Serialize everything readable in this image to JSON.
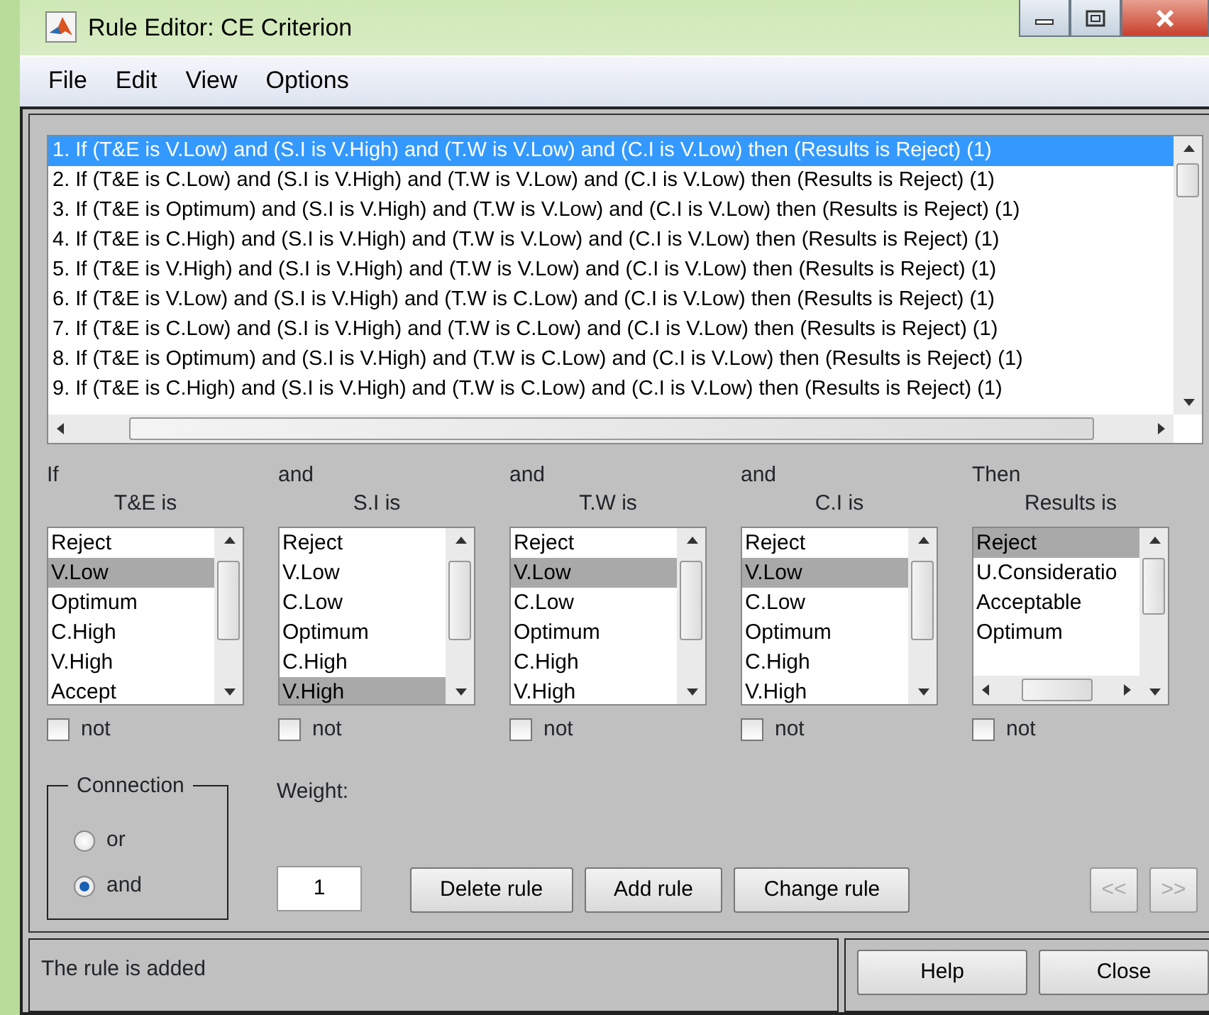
{
  "window": {
    "title": "Rule Editor: CE Criterion"
  },
  "menu": [
    "File",
    "Edit",
    "View",
    "Options"
  ],
  "rules": [
    {
      "text": "1. If (T&E is V.Low) and (S.I is V.High) and (T.W is V.Low) and (C.I is V.Low) then (Results is Reject) (1)",
      "selected": true
    },
    {
      "text": "2. If (T&E is C.Low) and (S.I is V.High) and (T.W is V.Low) and (C.I is V.Low) then (Results is Reject) (1)",
      "selected": false
    },
    {
      "text": "3. If (T&E is Optimum) and (S.I is V.High) and (T.W is V.Low) and (C.I is V.Low) then (Results is Reject) (1)",
      "selected": false
    },
    {
      "text": "4. If (T&E is C.High) and (S.I is V.High) and (T.W is V.Low) and (C.I is V.Low) then (Results is Reject) (1)",
      "selected": false
    },
    {
      "text": "5. If (T&E is V.High) and (S.I is V.High) and (T.W is V.Low) and (C.I is V.Low) then (Results is Reject) (1)",
      "selected": false
    },
    {
      "text": "6. If (T&E is V.Low) and (S.I is V.High) and (T.W is C.Low) and (C.I is V.Low) then (Results is Reject) (1)",
      "selected": false
    },
    {
      "text": "7. If (T&E is C.Low) and (S.I is V.High) and (T.W is C.Low) and (C.I is V.Low) then (Results is Reject) (1)",
      "selected": false
    },
    {
      "text": "8. If (T&E is Optimum) and (S.I is V.High) and (T.W is C.Low) and (C.I is V.Low) then (Results is Reject) (1)",
      "selected": false
    },
    {
      "text": "9. If (T&E is C.High) and (S.I is V.High) and (T.W is C.Low) and (C.I is V.Low) then (Results is Reject) (1)",
      "selected": false
    }
  ],
  "inputs": [
    {
      "connector": "If",
      "label": "T&E is",
      "hscroll": false,
      "not_label": "not",
      "not": false,
      "options": [
        {
          "label": "Reject",
          "selected": false
        },
        {
          "label": "V.Low",
          "selected": true
        },
        {
          "label": "Optimum",
          "selected": false
        },
        {
          "label": "C.High",
          "selected": false
        },
        {
          "label": "V.High",
          "selected": false
        },
        {
          "label": "Accept",
          "selected": false
        }
      ]
    },
    {
      "connector": "and",
      "label": "S.I is",
      "hscroll": false,
      "not_label": "not",
      "not": false,
      "options": [
        {
          "label": "Reject",
          "selected": false
        },
        {
          "label": "V.Low",
          "selected": false
        },
        {
          "label": "C.Low",
          "selected": false
        },
        {
          "label": "Optimum",
          "selected": false
        },
        {
          "label": "C.High",
          "selected": false
        },
        {
          "label": "V.High",
          "selected": true
        }
      ]
    },
    {
      "connector": "and",
      "label": "T.W is",
      "hscroll": false,
      "not_label": "not",
      "not": false,
      "options": [
        {
          "label": "Reject",
          "selected": false
        },
        {
          "label": "V.Low",
          "selected": true
        },
        {
          "label": "C.Low",
          "selected": false
        },
        {
          "label": "Optimum",
          "selected": false
        },
        {
          "label": "C.High",
          "selected": false
        },
        {
          "label": "V.High",
          "selected": false
        }
      ]
    },
    {
      "connector": "and",
      "label": "C.I is",
      "hscroll": false,
      "not_label": "not",
      "not": false,
      "options": [
        {
          "label": "Reject",
          "selected": false
        },
        {
          "label": "V.Low",
          "selected": true
        },
        {
          "label": "C.Low",
          "selected": false
        },
        {
          "label": "Optimum",
          "selected": false
        },
        {
          "label": "C.High",
          "selected": false
        },
        {
          "label": "V.High",
          "selected": false
        }
      ]
    },
    {
      "connector": "Then",
      "label": "Results is",
      "hscroll": true,
      "not_label": "not",
      "not": false,
      "options": [
        {
          "label": "Reject",
          "selected": true
        },
        {
          "label": "U.Consideratio",
          "selected": false
        },
        {
          "label": "Acceptable",
          "selected": false
        },
        {
          "label": "Optimum",
          "selected": false
        }
      ]
    }
  ],
  "connection": {
    "title": "Connection",
    "options": [
      {
        "label": "or",
        "selected": false
      },
      {
        "label": "and",
        "selected": true
      }
    ]
  },
  "weight": {
    "label": "Weight:",
    "value": "1"
  },
  "rule_buttons": [
    {
      "label": "Delete rule",
      "disabled": false
    },
    {
      "label": "Add rule",
      "disabled": false
    },
    {
      "label": "Change rule",
      "disabled": false
    }
  ],
  "nav_buttons": [
    {
      "label": "<<",
      "disabled": true
    },
    {
      "label": ">>",
      "disabled": true
    }
  ],
  "status": "The rule is added",
  "footer_buttons": [
    {
      "label": "Help",
      "disabled": false
    },
    {
      "label": "Close",
      "disabled": false
    }
  ]
}
